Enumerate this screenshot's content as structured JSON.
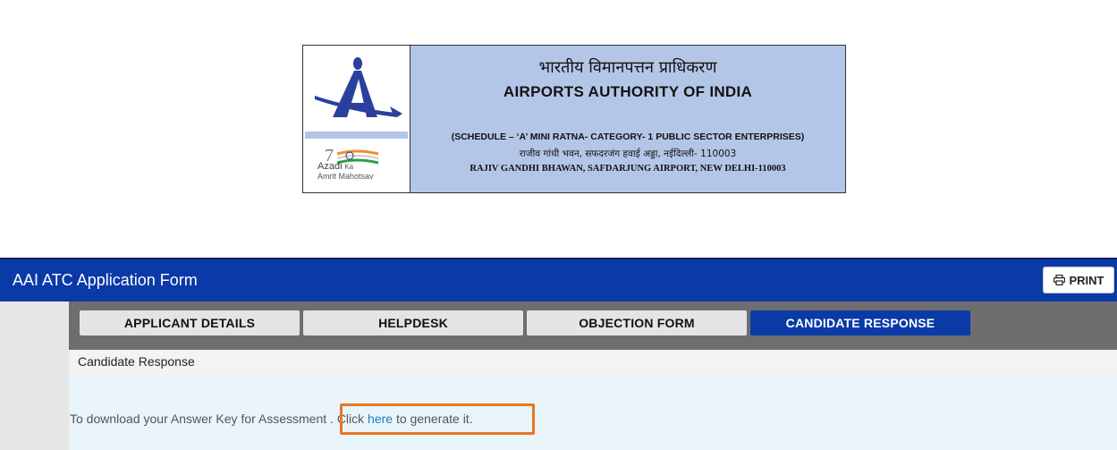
{
  "banner": {
    "hindi_title": "भारतीय विमानपत्तन प्राधिकरण",
    "english_title": "AIRPORTS AUTHORITY OF INDIA",
    "schedule": "(SCHEDULE – ‘A’ MINI RATNA- CATEGORY- 1 PUBLIC SECTOR ENTERPRISES)",
    "hindi_address": "राजीव गांधी भवन, सफदरजंग हवाई अड्डा, नईदिल्ली- 110003",
    "english_address": "RAJIV GANDHI BHAWAN, SAFDARJUNG AIRPORT, NEW DELHI-110003",
    "logo_text": "AAI",
    "azadi_line1": "Azadi",
    "azadi_line2": "Ka",
    "azadi_line3": "Amrit Mahotsav",
    "logo_color": "#2b3f9e"
  },
  "header": {
    "title": "AAI ATC Application Form",
    "print_label": "PRINT",
    "background": "#0a3aa8"
  },
  "tabs": [
    {
      "label": "APPLICANT DETAILS",
      "active": false
    },
    {
      "label": "HELPDESK",
      "active": false
    },
    {
      "label": "OBJECTION FORM",
      "active": false
    },
    {
      "label": "CANDIDATE RESPONSE",
      "active": true
    }
  ],
  "section": {
    "title": "Candidate Response",
    "text_before": "To download your Answer Key for Assessment . Click ",
    "link_text": "here",
    "text_after": " to generate it."
  },
  "colors": {
    "highlight": "#e87722",
    "link": "#1a7fc0"
  }
}
